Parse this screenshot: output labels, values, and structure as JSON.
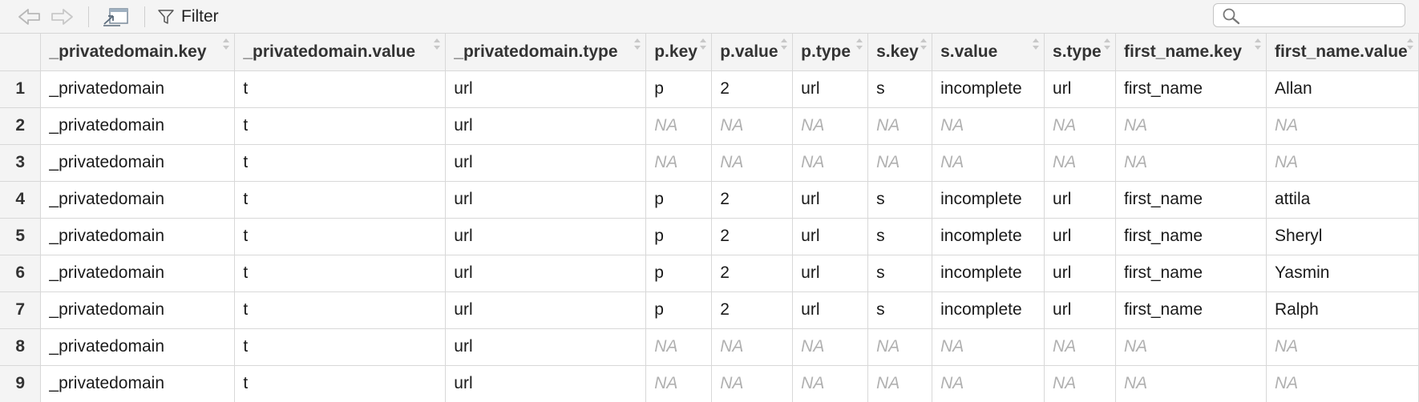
{
  "toolbar": {
    "back_icon": "back-arrow-icon",
    "forward_icon": "forward-arrow-icon",
    "popout_icon": "popout-window-icon",
    "filter_label": "Filter",
    "filter_icon": "funnel-icon",
    "search_icon": "search-icon",
    "search_value": ""
  },
  "table": {
    "columns": [
      "_privatedomain.key",
      "_privatedomain.value",
      "_privatedomain.type",
      "p.key",
      "p.value",
      "p.type",
      "s.key",
      "s.value",
      "s.type",
      "first_name.key",
      "first_name.value"
    ],
    "rows": [
      {
        "num": "1",
        "cells": [
          "_privatedomain",
          "t",
          "url",
          "p",
          "2",
          "url",
          "s",
          "incomplete",
          "url",
          "first_name",
          "Allan"
        ]
      },
      {
        "num": "2",
        "cells": [
          "_privatedomain",
          "t",
          "url",
          "NA",
          "NA",
          "NA",
          "NA",
          "NA",
          "NA",
          "NA",
          "NA"
        ]
      },
      {
        "num": "3",
        "cells": [
          "_privatedomain",
          "t",
          "url",
          "NA",
          "NA",
          "NA",
          "NA",
          "NA",
          "NA",
          "NA",
          "NA"
        ]
      },
      {
        "num": "4",
        "cells": [
          "_privatedomain",
          "t",
          "url",
          "p",
          "2",
          "url",
          "s",
          "incomplete",
          "url",
          "first_name",
          "attila"
        ]
      },
      {
        "num": "5",
        "cells": [
          "_privatedomain",
          "t",
          "url",
          "p",
          "2",
          "url",
          "s",
          "incomplete",
          "url",
          "first_name",
          "Sheryl"
        ]
      },
      {
        "num": "6",
        "cells": [
          "_privatedomain",
          "t",
          "url",
          "p",
          "2",
          "url",
          "s",
          "incomplete",
          "url",
          "first_name",
          "Yasmin"
        ]
      },
      {
        "num": "7",
        "cells": [
          "_privatedomain",
          "t",
          "url",
          "p",
          "2",
          "url",
          "s",
          "incomplete",
          "url",
          "first_name",
          "Ralph"
        ]
      },
      {
        "num": "8",
        "cells": [
          "_privatedomain",
          "t",
          "url",
          "NA",
          "NA",
          "NA",
          "NA",
          "NA",
          "NA",
          "NA",
          "NA"
        ]
      },
      {
        "num": "9",
        "cells": [
          "_privatedomain",
          "t",
          "url",
          "NA",
          "NA",
          "NA",
          "NA",
          "NA",
          "NA",
          "NA",
          "NA"
        ]
      }
    ]
  }
}
